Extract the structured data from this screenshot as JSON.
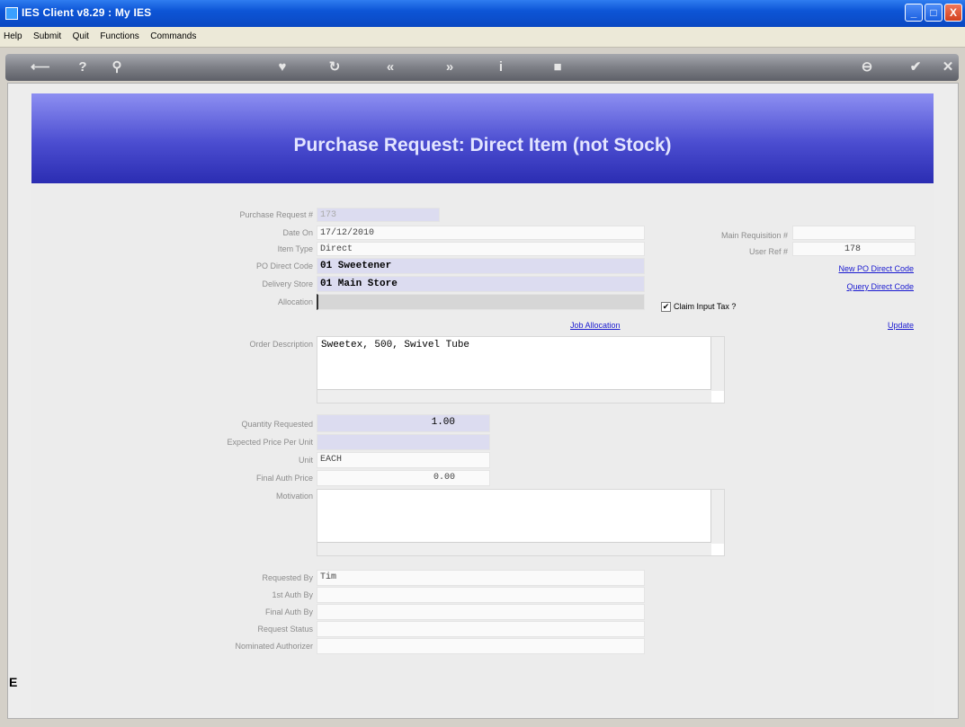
{
  "window": {
    "title": "IES Client v8.29 : My IES",
    "min": "_",
    "max": "□",
    "close": "X"
  },
  "menu": [
    "Help",
    "Submit",
    "Quit",
    "Functions",
    "Commands"
  ],
  "toolbar_icons": [
    "back-arrow-icon",
    "help-icon",
    "search-icon",
    "heart-icon",
    "refresh-icon",
    "rewind-icon",
    "fast-forward-icon",
    "info-icon",
    "stop-icon",
    "minus-icon",
    "check-icon",
    "close-icon"
  ],
  "banner": {
    "title": "Purchase Request: Direct Item (not Stock)"
  },
  "form": {
    "purchase_request_label": "Purchase Request #",
    "purchase_request_value": "173",
    "date_on_label": "Date On",
    "date_on_value": "17/12/2010",
    "item_type_label": "Item Type",
    "item_type_value": "Direct",
    "po_direct_code_label": "PO Direct Code",
    "po_direct_code_value": "01 Sweetener",
    "delivery_store_label": "Delivery Store",
    "delivery_store_value": "01 Main Store",
    "allocation_label": "Allocation",
    "allocation_value": "",
    "main_requisition_label": "Main Requisition #",
    "main_requisition_value": "",
    "user_ref_label": "User Ref #",
    "user_ref_value": "178",
    "new_po_direct_code": "New PO Direct Code",
    "query_direct_code": "Query Direct Code",
    "claim_input_tax": "Claim Input Tax ?",
    "claim_input_tax_checked": "✔",
    "job_allocation": "Job Allocation",
    "update": "Update",
    "order_description_label": "Order Description",
    "order_description_value": "Sweetex, 500, Swivel Tube",
    "quantity_label": "Quantity Requested",
    "quantity_value": "1.00",
    "expected_price_label": "Expected Price Per Unit",
    "expected_price_value": "",
    "unit_label": "Unit",
    "unit_value": "EACH",
    "final_auth_price_label": "Final Auth Price",
    "final_auth_price_value": "0.00",
    "motivation_label": "Motivation",
    "motivation_value": "",
    "requested_by_label": "Requested By",
    "requested_by_value": "Tim",
    "first_auth_label": "1st Auth By",
    "first_auth_value": "",
    "final_auth_by_label": "Final Auth By",
    "final_auth_by_value": "",
    "request_status_label": "Request Status",
    "request_status_value": "",
    "nominated_authorizer_label": "Nominated Authorizer",
    "nominated_authorizer_value": ""
  },
  "left_cursor": "E"
}
